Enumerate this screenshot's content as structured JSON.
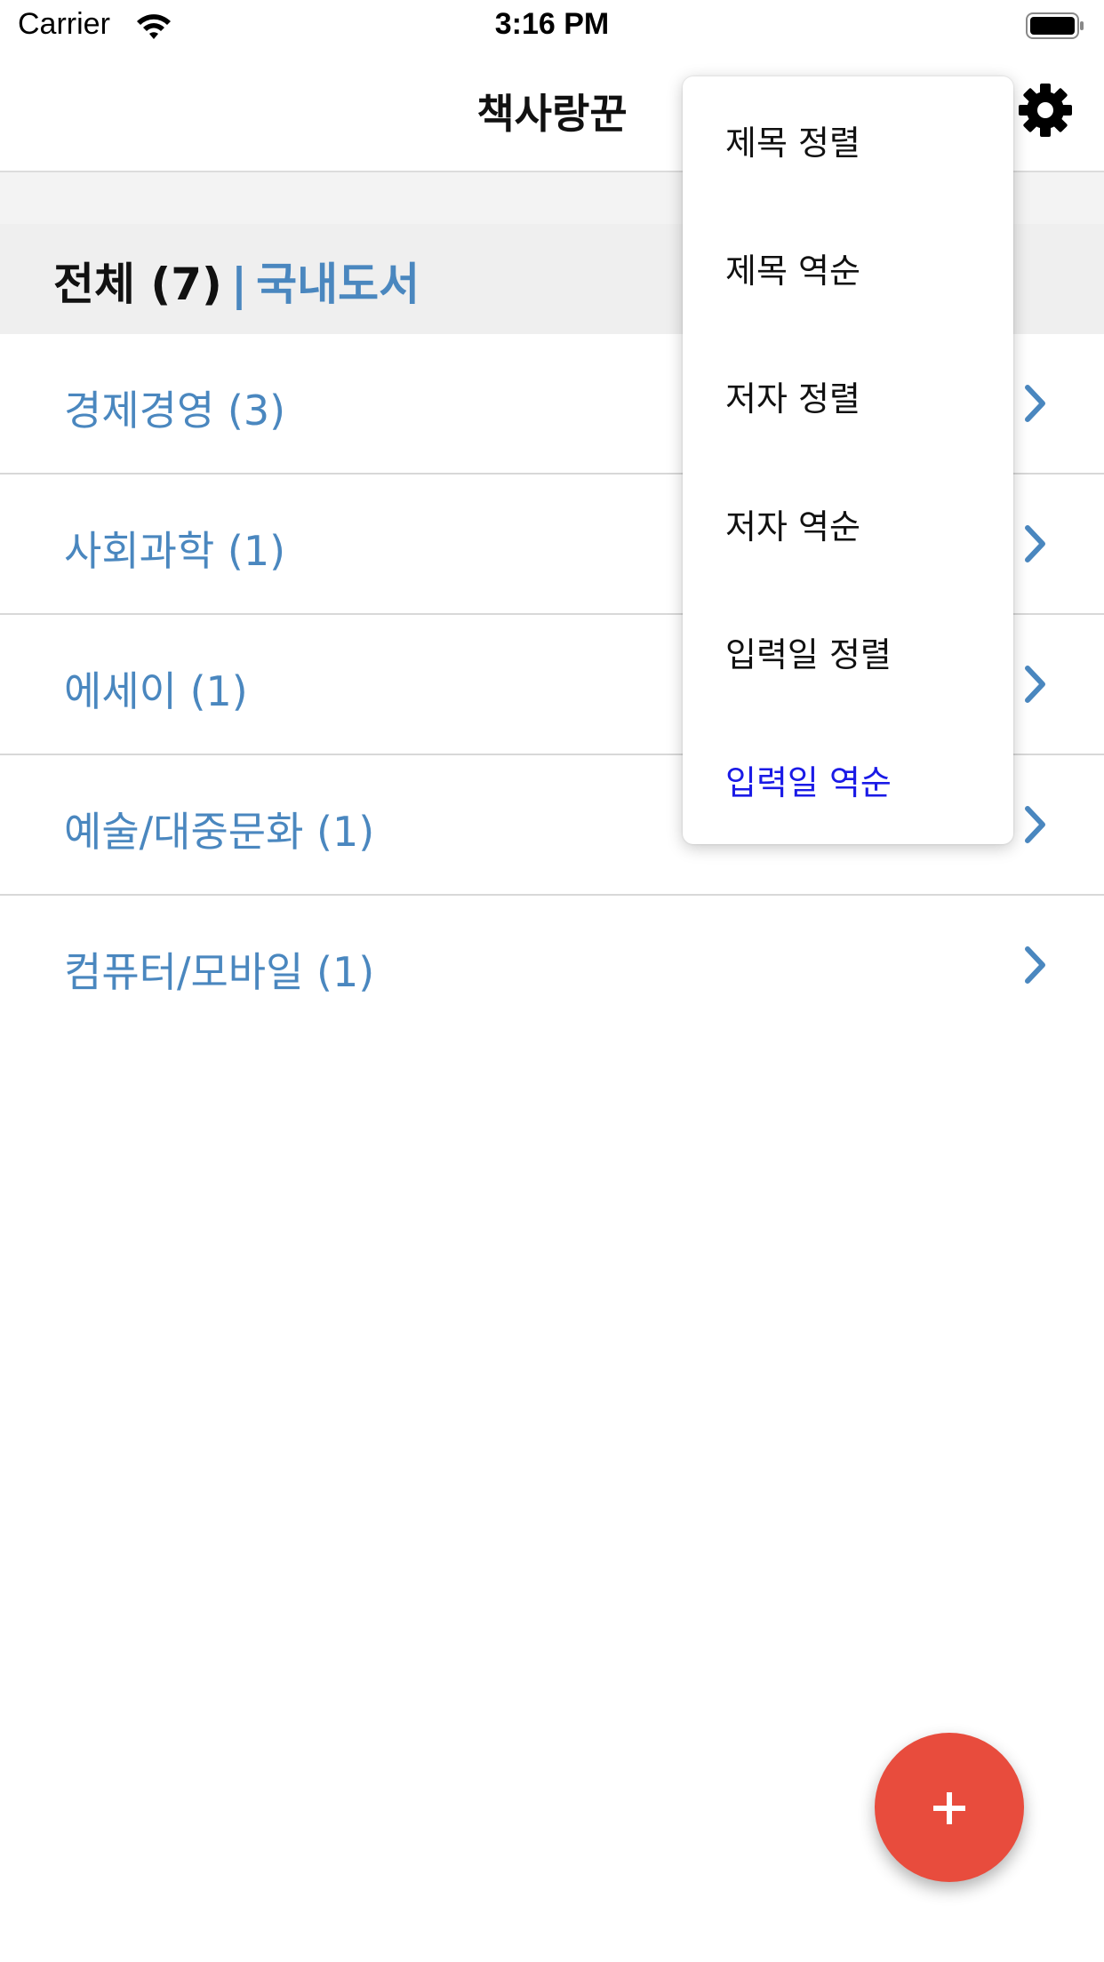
{
  "status_bar": {
    "carrier": "Carrier",
    "time": "3:16 PM"
  },
  "nav": {
    "title": "책사랑꾼",
    "settings_icon": "gear-icon"
  },
  "header": {
    "all_label": "전체 (7)",
    "separator": "|",
    "category": "국내도서"
  },
  "categories": [
    {
      "label": "경제경영 (3)"
    },
    {
      "label": "사회과학 (1)"
    },
    {
      "label": "에세이 (1)"
    },
    {
      "label": "예술/대중문화 (1)"
    },
    {
      "label": "컴퓨터/모바일 (1)"
    }
  ],
  "sort_menu": {
    "items": [
      {
        "label": "제목 정렬"
      },
      {
        "label": "제목 역순"
      },
      {
        "label": "저자 정렬"
      },
      {
        "label": "저자 역순"
      },
      {
        "label": "입력일 정렬"
      },
      {
        "label": "입력일 역순",
        "selected": true
      }
    ]
  },
  "fab": {
    "label": "+",
    "color": "#e84c3d"
  },
  "colors": {
    "accent": "#4a87bf",
    "selected_menu": "#1a1ae6"
  }
}
